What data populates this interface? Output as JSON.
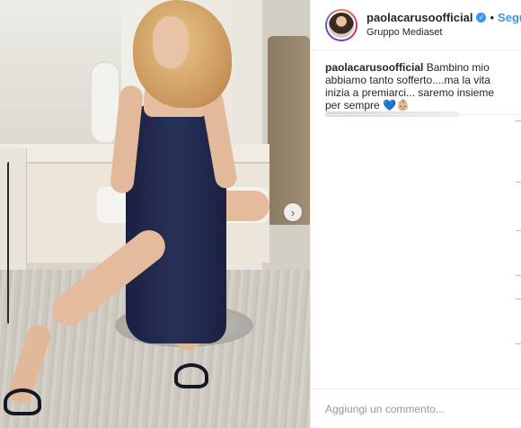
{
  "post": {
    "header": {
      "username": "paolacarusoofficial",
      "verified_icon": "verified-badge-icon",
      "separator": "•",
      "follow_label": "Segui",
      "location": "Gruppo Mediaset"
    },
    "caption": {
      "author": "paolacarusoofficial",
      "text": "Bambino mio abbiamo tanto sofferto....ma la vita inizia a premiarci... saremo insieme per sempre 💙👶🏼"
    },
    "photo": {
      "next_icon": "chevron-right-icon"
    },
    "comment": {
      "placeholder": "Aggiungi un commento..."
    },
    "colors": {
      "accent": "#3897f0",
      "text": "#262626",
      "border": "#efefef"
    }
  }
}
